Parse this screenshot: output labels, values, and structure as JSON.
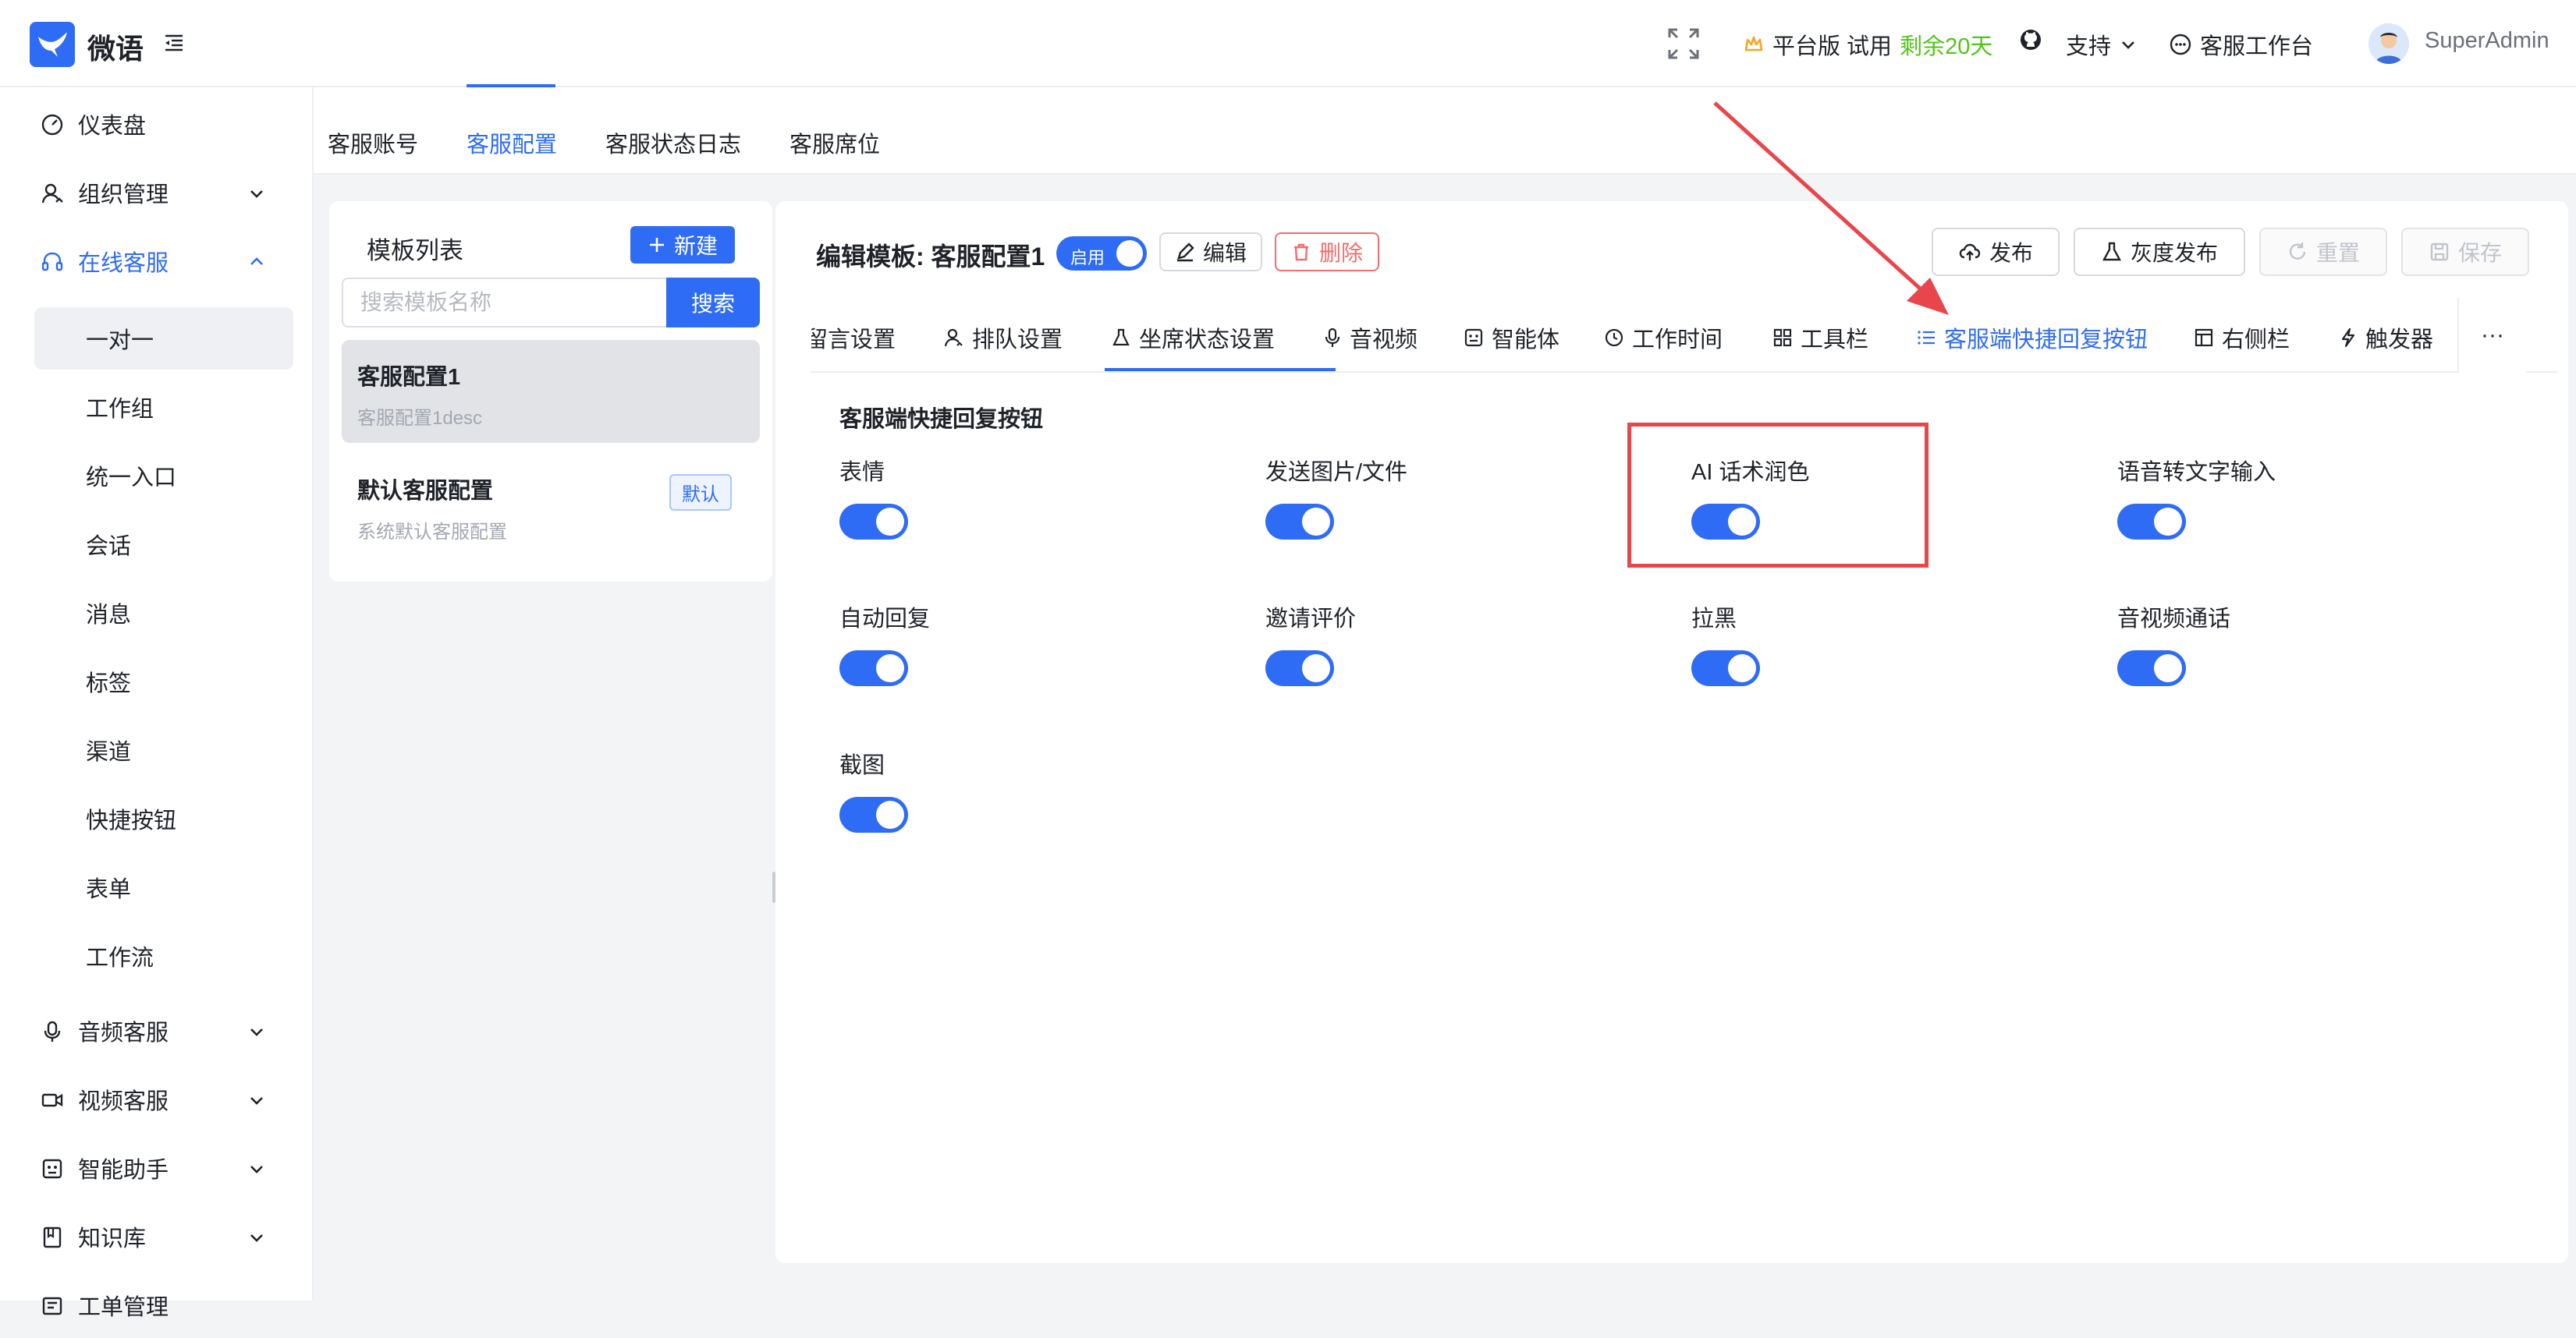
{
  "header": {
    "brand": "微语",
    "plan_label": "平台版 试用",
    "trial_remaining": "剩余20天",
    "support_label": "支持",
    "workbench_label": "客服工作台",
    "username": "SuperAdmin"
  },
  "sidebar": {
    "items": [
      {
        "label": "仪表盘",
        "icon": "dashboard-icon"
      },
      {
        "label": "组织管理",
        "icon": "org-icon"
      },
      {
        "label": "在线客服",
        "icon": "headset-icon"
      },
      {
        "label": "音频客服",
        "icon": "mic-icon"
      },
      {
        "label": "视频客服",
        "icon": "video-icon"
      },
      {
        "label": "智能助手",
        "icon": "robot-icon"
      },
      {
        "label": "知识库",
        "icon": "book-icon"
      },
      {
        "label": "工单管理",
        "icon": "ticket-icon"
      }
    ],
    "sub_items": [
      "一对一",
      "工作组",
      "统一入口",
      "会话",
      "消息",
      "标签",
      "渠道",
      "快捷按钮",
      "表单",
      "工作流"
    ]
  },
  "top_tabs": [
    "客服账号",
    "客服配置",
    "客服状态日志",
    "客服席位"
  ],
  "template_list": {
    "title": "模板列表",
    "new_label": "新建",
    "search_placeholder": "搜索模板名称",
    "search_label": "搜索",
    "templates": [
      {
        "name": "客服配置1",
        "desc": "客服配置1desc"
      },
      {
        "name": "默认客服配置",
        "desc": "系统默认客服配置",
        "badge": "默认"
      }
    ]
  },
  "editor": {
    "title": "编辑模板: 客服配置1",
    "enabled_label": "启用",
    "edit_label": "编辑",
    "delete_label": "删除",
    "publish_label": "发布",
    "gray_publish_label": "灰度发布",
    "reset_label": "重置",
    "save_label": "保存",
    "more_label": "···",
    "tabs": [
      {
        "label": "留言设置",
        "icon": ""
      },
      {
        "label": "排队设置",
        "icon": "queue-icon"
      },
      {
        "label": "坐席状态设置",
        "icon": "flask-icon"
      },
      {
        "label": "音视频",
        "icon": "mic-icon"
      },
      {
        "label": "智能体",
        "icon": "robot-icon"
      },
      {
        "label": "工作时间",
        "icon": "clock-icon"
      },
      {
        "label": "工具栏",
        "icon": "grid-icon"
      },
      {
        "label": "客服端快捷回复按钮",
        "icon": "list-icon"
      },
      {
        "label": "右侧栏",
        "icon": "layout-icon"
      },
      {
        "label": "触发器",
        "icon": "bolt-icon"
      }
    ],
    "section_title": "客服端快捷回复按钮",
    "options": [
      {
        "label": "表情",
        "enabled": true
      },
      {
        "label": "发送图片/文件",
        "enabled": true
      },
      {
        "label": "AI 话术润色",
        "enabled": true
      },
      {
        "label": "语音转文字输入",
        "enabled": true
      },
      {
        "label": "自动回复",
        "enabled": true
      },
      {
        "label": "邀请评价",
        "enabled": true
      },
      {
        "label": "拉黑",
        "enabled": true
      },
      {
        "label": "音视频通话",
        "enabled": true
      },
      {
        "label": "截图",
        "enabled": true
      }
    ]
  },
  "colors": {
    "primary": "#2f6cf6",
    "danger": "#f56c6c",
    "highlight": "#e8464b",
    "trial": "#52c41a"
  }
}
